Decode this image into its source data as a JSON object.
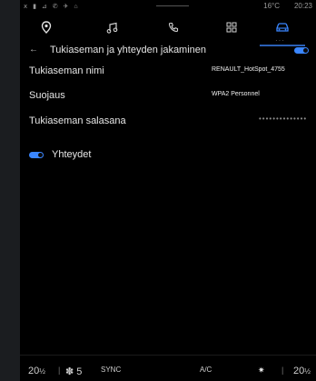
{
  "status": {
    "temperature": "16°C",
    "time": "20:23"
  },
  "nav": {
    "tabs": [
      {
        "name": "navigation-tab",
        "icon": "location-pin-icon"
      },
      {
        "name": "music-tab",
        "icon": "music-note-icon"
      },
      {
        "name": "phone-tab",
        "icon": "phone-icon"
      },
      {
        "name": "apps-tab",
        "icon": "apps-grid-icon"
      },
      {
        "name": "vehicle-tab",
        "icon": "car-icon",
        "active": true
      }
    ]
  },
  "header": {
    "title": "Tukiaseman ja yhteyden jakaminen"
  },
  "settings": {
    "hotspot_name_label": "Tukiaseman nimi",
    "hotspot_name_value": "RENAULT_HotSpot_4755",
    "security_label": "Suojaus",
    "security_value": "WPA2 Personnel",
    "password_label": "Tukiaseman salasana",
    "password_value": "••••••••••••••",
    "connections_label": "Yhteydet"
  },
  "climate": {
    "left_temp": "20",
    "fan_level": "5",
    "sync_label": "SYNC",
    "ac_label": "A/C",
    "right_temp": "20"
  },
  "colors": {
    "accent": "#3a86ff",
    "background": "#000000"
  }
}
